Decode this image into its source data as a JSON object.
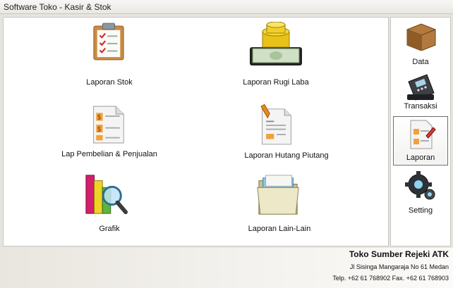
{
  "window": {
    "title": "Software Toko - Kasir & Stok"
  },
  "menu": [
    {
      "label": "Laporan Stok",
      "icon": "clipboard-checklist-icon"
    },
    {
      "label": "Laporan Rugi Laba",
      "icon": "money-stack-icon"
    },
    {
      "label": "Lap Pembelian & Penjualan",
      "icon": "dollar-document-icon"
    },
    {
      "label": "Laporan Hutang Piutang",
      "icon": "pen-document-icon"
    },
    {
      "label": "Grafik",
      "icon": "bar-chart-magnifier-icon"
    },
    {
      "label": "Laporan Lain-Lain",
      "icon": "folder-icon"
    }
  ],
  "sidebar": [
    {
      "label": "Data",
      "icon": "cardboard-box-icon"
    },
    {
      "label": "Transaksi",
      "icon": "card-terminal-icon"
    },
    {
      "label": "Laporan",
      "icon": "report-document-icon",
      "active": true
    },
    {
      "label": "Setting",
      "icon": "gears-icon"
    }
  ],
  "footer": {
    "store_name": "Toko Sumber Rejeki ATK",
    "address": "Jl Sisinga Mangaraja No 61 Medan",
    "contact": "Telp. +62 61 768902 Fax. +62 61 768903"
  }
}
